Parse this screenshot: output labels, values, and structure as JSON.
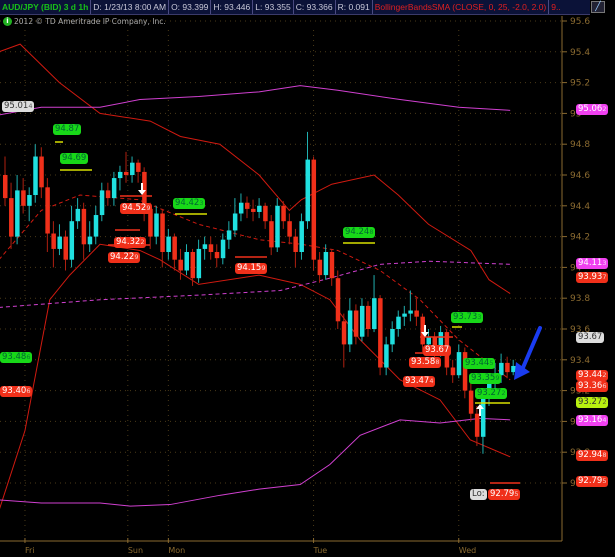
{
  "header": {
    "symbol": "AUD/JPY (BID) 3 d 1h",
    "date": "D: 1/23/13 8:00 AM",
    "open": "O: 93.399",
    "high": "H: 93.446",
    "low": "L: 93.355",
    "close": "C: 93.366",
    "range": "R: 0.091",
    "study": "BollingerBandsSMA (CLOSE, 0, 25, -2.0, 2.0)",
    "more": "9.."
  },
  "copyright": "2012 © TD Ameritrade IP Company, Inc.",
  "colors": {
    "up": "#20e0e0",
    "down": "#f0301a",
    "band": "#d01a10",
    "band2": "#d040d0",
    "arrow": "#1a3cf0"
  },
  "chart_data": {
    "type": "candlestick",
    "title": "AUD/JPY (BID) 3 d 1h",
    "ylim": [
      92.5,
      95.7
    ],
    "yticks": [
      "95.6",
      "95.4",
      "95.2",
      "95",
      "94.8",
      "94.6",
      "94.4",
      "94.2",
      "94",
      "93.8",
      "93.6",
      "93.4",
      "93.2",
      "93",
      "92.8",
      "92.6"
    ],
    "yticks_v": [
      95.6,
      95.4,
      95.2,
      95,
      94.8,
      94.6,
      94.4,
      94.2,
      94,
      93.8,
      93.6,
      93.4,
      93.2,
      93,
      92.8,
      92.6
    ],
    "xlabels": [
      "Fri",
      "Sun",
      "Mon",
      "Tue",
      "Wed"
    ],
    "xlabels_i": [
      3.3,
      20.3,
      27,
      51,
      75
    ],
    "ohlc": [
      [
        94.6,
        94.72,
        94.4,
        94.45
      ],
      [
        94.45,
        94.55,
        94.12,
        94.2
      ],
      [
        94.2,
        94.6,
        94.15,
        94.5
      ],
      [
        94.5,
        94.58,
        94.35,
        94.4
      ],
      [
        94.4,
        94.52,
        94.3,
        94.47
      ],
      [
        94.47,
        94.8,
        94.42,
        94.72
      ],
      [
        94.72,
        94.78,
        94.45,
        94.52
      ],
      [
        94.52,
        94.58,
        94.1,
        94.22
      ],
      [
        94.22,
        94.3,
        94.0,
        94.12
      ],
      [
        94.12,
        94.28,
        94.08,
        94.2
      ],
      [
        94.2,
        94.24,
        93.98,
        94.05
      ],
      [
        94.05,
        94.4,
        94.0,
        94.3
      ],
      [
        94.3,
        94.45,
        94.25,
        94.38
      ],
      [
        94.38,
        94.42,
        94.05,
        94.15
      ],
      [
        94.15,
        94.3,
        94.1,
        94.2
      ],
      [
        94.2,
        94.4,
        94.15,
        94.34
      ],
      [
        94.34,
        94.55,
        94.3,
        94.5
      ],
      [
        94.5,
        94.55,
        94.4,
        94.45
      ],
      [
        94.45,
        94.62,
        94.4,
        94.58
      ],
      [
        94.58,
        94.66,
        94.5,
        94.62
      ],
      [
        94.62,
        94.75,
        94.55,
        94.6
      ],
      [
        94.6,
        94.72,
        94.55,
        94.68
      ],
      [
        94.68,
        94.7,
        94.55,
        94.62
      ],
      [
        94.62,
        94.65,
        94.3,
        94.38
      ],
      [
        94.38,
        94.42,
        94.12,
        94.2
      ],
      [
        94.2,
        94.4,
        94.15,
        94.35
      ],
      [
        94.35,
        94.38,
        94.0,
        94.1
      ],
      [
        94.1,
        94.25,
        94.05,
        94.2
      ],
      [
        94.2,
        94.22,
        93.98,
        94.05
      ],
      [
        94.05,
        94.12,
        93.92,
        93.98
      ],
      [
        93.98,
        94.15,
        93.95,
        94.1
      ],
      [
        94.1,
        94.12,
        93.88,
        93.93
      ],
      [
        93.93,
        94.18,
        93.9,
        94.12
      ],
      [
        94.12,
        94.2,
        94.05,
        94.15
      ],
      [
        94.15,
        94.2,
        94.05,
        94.1
      ],
      [
        94.1,
        94.15,
        94.0,
        94.06
      ],
      [
        94.06,
        94.22,
        94.02,
        94.18
      ],
      [
        94.18,
        94.3,
        94.12,
        94.24
      ],
      [
        94.24,
        94.45,
        94.2,
        94.35
      ],
      [
        94.35,
        94.48,
        94.3,
        94.42
      ],
      [
        94.42,
        94.46,
        94.32,
        94.38
      ],
      [
        94.38,
        94.44,
        94.3,
        94.36
      ],
      [
        94.36,
        94.45,
        94.32,
        94.4
      ],
      [
        94.4,
        94.42,
        94.25,
        94.3
      ],
      [
        94.3,
        94.34,
        94.08,
        94.13
      ],
      [
        94.13,
        94.45,
        94.1,
        94.4
      ],
      [
        94.4,
        94.43,
        94.25,
        94.3
      ],
      [
        94.3,
        94.35,
        94.15,
        94.2
      ],
      [
        94.2,
        94.25,
        94.0,
        94.1
      ],
      [
        94.1,
        94.35,
        94.05,
        94.3
      ],
      [
        94.3,
        94.88,
        94.25,
        94.7
      ],
      [
        94.7,
        94.72,
        93.98,
        94.05
      ],
      [
        94.05,
        94.1,
        93.9,
        93.95
      ],
      [
        93.95,
        94.15,
        93.92,
        94.1
      ],
      [
        94.1,
        94.12,
        93.88,
        93.93
      ],
      [
        93.93,
        93.98,
        93.6,
        93.65
      ],
      [
        93.65,
        93.7,
        93.35,
        93.5
      ],
      [
        93.5,
        93.8,
        93.45,
        93.72
      ],
      [
        93.72,
        93.76,
        93.5,
        93.55
      ],
      [
        93.55,
        93.8,
        93.52,
        93.75
      ],
      [
        93.75,
        93.78,
        93.55,
        93.6
      ],
      [
        93.6,
        93.95,
        93.58,
        93.8
      ],
      [
        93.8,
        93.82,
        93.3,
        93.35
      ],
      [
        93.35,
        93.55,
        93.3,
        93.5
      ],
      [
        93.5,
        93.65,
        93.45,
        93.6
      ],
      [
        93.6,
        93.72,
        93.55,
        93.68
      ],
      [
        93.68,
        93.75,
        93.62,
        93.7
      ],
      [
        93.7,
        93.85,
        93.65,
        93.72
      ],
      [
        93.72,
        93.8,
        93.62,
        93.68
      ],
      [
        93.68,
        93.7,
        93.45,
        93.5
      ],
      [
        93.5,
        93.6,
        93.45,
        93.55
      ],
      [
        93.55,
        93.58,
        93.4,
        93.45
      ],
      [
        93.45,
        93.62,
        93.42,
        93.58
      ],
      [
        93.58,
        93.6,
        93.3,
        93.35
      ],
      [
        93.35,
        93.4,
        93.25,
        93.3
      ],
      [
        93.3,
        93.5,
        93.28,
        93.45
      ],
      [
        93.45,
        93.48,
        93.15,
        93.2
      ],
      [
        93.2,
        93.25,
        93.0,
        93.05
      ],
      [
        93.05,
        93.1,
        92.84,
        92.9
      ],
      [
        92.9,
        93.2,
        92.79,
        93.15
      ],
      [
        93.15,
        93.3,
        93.1,
        93.25
      ],
      [
        93.25,
        93.38,
        93.2,
        93.3
      ],
      [
        93.3,
        93.44,
        93.25,
        93.38
      ],
      [
        93.38,
        93.42,
        93.28,
        93.32
      ],
      [
        93.32,
        93.4,
        93.3,
        93.36
      ]
    ],
    "bands": [
      {
        "name": "upper-bollinger",
        "color": "#d01a10",
        "dash": false,
        "points": [
          [
            -1,
            95.4
          ],
          [
            2.5,
            95.45
          ],
          [
            9,
            95.2
          ],
          [
            15.7,
            95.0
          ],
          [
            24,
            94.95
          ],
          [
            29,
            94.85
          ],
          [
            35.5,
            94.8
          ],
          [
            42,
            94.6
          ],
          [
            47,
            94.37
          ],
          [
            49,
            94.44
          ],
          [
            54,
            94.54
          ],
          [
            61,
            94.6
          ],
          [
            65,
            94.47
          ],
          [
            70,
            94.28
          ],
          [
            77,
            94.11
          ],
          [
            80,
            93.92
          ],
          [
            83.5,
            93.83
          ]
        ]
      },
      {
        "name": "middle-bollinger",
        "color": "#d01a10",
        "dash": true,
        "points": [
          [
            -1,
            94.05
          ],
          [
            6,
            94.37
          ],
          [
            12.4,
            94.47
          ],
          [
            22,
            94.44
          ],
          [
            32,
            94.28
          ],
          [
            42,
            94.18
          ],
          [
            49,
            94.15
          ],
          [
            55,
            94.11
          ],
          [
            62,
            93.98
          ],
          [
            68.6,
            93.79
          ],
          [
            75,
            93.53
          ],
          [
            83.5,
            93.27
          ]
        ]
      },
      {
        "name": "lower-bollinger",
        "color": "#d01a10",
        "dash": false,
        "points": [
          [
            -1,
            92.42
          ],
          [
            3.3,
            92.94
          ],
          [
            7.4,
            93.79
          ],
          [
            10.7,
            93.95
          ],
          [
            15.7,
            94.15
          ],
          [
            22.3,
            94.11
          ],
          [
            25.6,
            94.05
          ],
          [
            32,
            93.89
          ],
          [
            42,
            93.95
          ],
          [
            48.8,
            93.89
          ],
          [
            53.7,
            93.79
          ],
          [
            58.7,
            93.53
          ],
          [
            65.3,
            93.27
          ],
          [
            71.9,
            93.14
          ],
          [
            76.9,
            92.88
          ],
          [
            83.5,
            92.77
          ]
        ]
      },
      {
        "name": "upper-band-2",
        "color": "#d040d0",
        "dash": false,
        "points": [
          [
            -1,
            94.99
          ],
          [
            6,
            95.04
          ],
          [
            15.7,
            95.04
          ],
          [
            22.3,
            95.09
          ],
          [
            32,
            95.11
          ],
          [
            42,
            95.14
          ],
          [
            48.8,
            95.18
          ],
          [
            55,
            95.15
          ],
          [
            65.3,
            95.09
          ],
          [
            75,
            95.04
          ],
          [
            83.5,
            95.02
          ]
        ]
      },
      {
        "name": "middle-band-2",
        "color": "#d040d0",
        "dash": true,
        "points": [
          [
            -1,
            93.74
          ],
          [
            15.7,
            93.79
          ],
          [
            32,
            93.82
          ],
          [
            45.5,
            93.85
          ],
          [
            53.7,
            93.93
          ],
          [
            62,
            94.02
          ],
          [
            70.2,
            94.04
          ],
          [
            83.5,
            94.02
          ]
        ]
      },
      {
        "name": "lower-band-2",
        "color": "#d040d0",
        "dash": false,
        "points": [
          [
            -1,
            92.49
          ],
          [
            6,
            92.47
          ],
          [
            15.7,
            92.47
          ],
          [
            20.7,
            92.45
          ],
          [
            27.3,
            92.46
          ],
          [
            35.5,
            92.52
          ],
          [
            42,
            92.56
          ],
          [
            48.8,
            92.59
          ],
          [
            53.7,
            92.72
          ],
          [
            58.7,
            92.91
          ],
          [
            65.3,
            93.01
          ],
          [
            71.9,
            92.99
          ],
          [
            78.5,
            93.02
          ],
          [
            83.5,
            93.01
          ]
        ]
      }
    ],
    "bubbles": {
      "b1": [
        "95.01",
        "4"
      ],
      "b2": [
        "94.87",
        ""
      ],
      "b3": [
        "94.69",
        ""
      ],
      "b4": [
        "94.52",
        "9"
      ],
      "b5": [
        "94.32",
        "2"
      ],
      "b6": [
        "94.22",
        "9"
      ],
      "b7": [
        "94.42",
        "3"
      ],
      "b8": [
        "94.15",
        "9"
      ],
      "b9": [
        "94.24",
        "8"
      ],
      "b10": [
        "93.73",
        "3"
      ],
      "b11": [
        "93.67",
        ""
      ],
      "b12": [
        "93.58",
        "8"
      ],
      "b13": [
        "93.47",
        "4"
      ],
      "b14": [
        "93.44",
        "5"
      ],
      "b15": [
        "93.35",
        "9"
      ],
      "b16": [
        "93.27",
        "2"
      ],
      "b17": [
        "93.48",
        "6"
      ],
      "b18": [
        "93.40",
        "6"
      ],
      "b19": [
        "92.79",
        "5"
      ],
      "lo": "Lo:"
    },
    "axis_bubbles": {
      "a1": [
        "95.06",
        "2"
      ],
      "a2": [
        "94.11",
        "3"
      ],
      "a3": [
        "93.93",
        "7"
      ],
      "a4": [
        "93.67",
        ""
      ],
      "a5": [
        "93.44",
        "2"
      ],
      "a6": [
        "93.36",
        "6"
      ],
      "a7": [
        "93.27",
        "2"
      ],
      "a8": [
        "93.16",
        "4"
      ],
      "a9": [
        "92.94",
        "8"
      ],
      "a10": [
        "92.79",
        "5"
      ]
    }
  }
}
